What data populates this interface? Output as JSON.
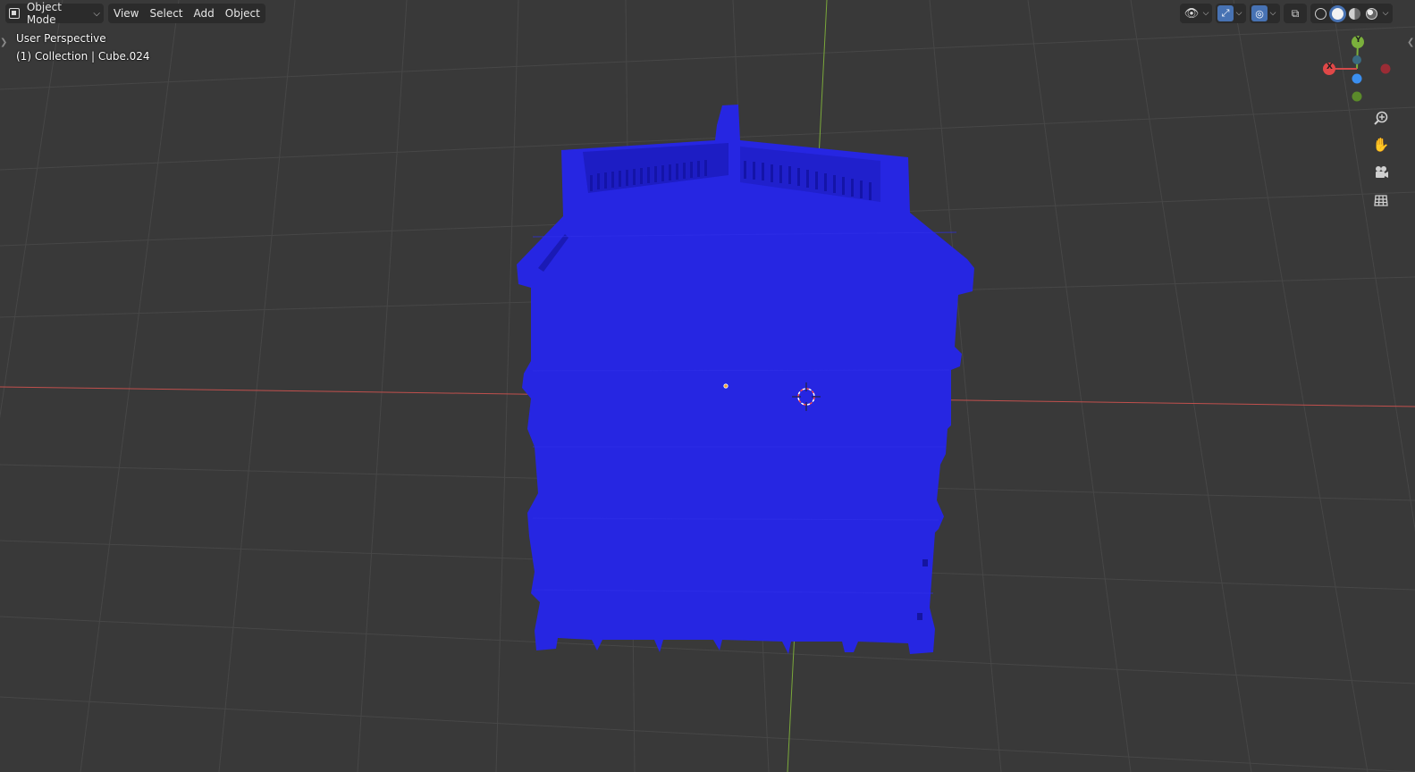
{
  "header": {
    "mode_label": "Object Mode",
    "menus": [
      "View",
      "Select",
      "Add",
      "Object"
    ]
  },
  "overlay": {
    "perspective": "User Perspective",
    "collection": "(1) Collection | Cube.024"
  },
  "gizmo": {
    "axis_y_label": "Y",
    "axis_x_label": "X"
  },
  "icons": {
    "mode": "object-mode-icon",
    "visibility": "eye-icon",
    "gizmo": "gizmo-icon",
    "overlays": "overlays-icon",
    "xray": "xray-icon",
    "wireframe": "wireframe-shading-icon",
    "solid": "solid-shading-icon",
    "material": "material-shading-icon",
    "rendered": "rendered-shading-icon",
    "zoom": "zoom-icon",
    "pan": "hand-icon",
    "camera": "camera-icon",
    "ortho": "grid-icon"
  },
  "colors": {
    "background": "#393939",
    "grid": "#4a4a4a",
    "mesh": "#2a2ae0",
    "x_axis": "#d24a4a",
    "y_axis": "#7bb03c",
    "z_axis": "#3b8ff0"
  }
}
